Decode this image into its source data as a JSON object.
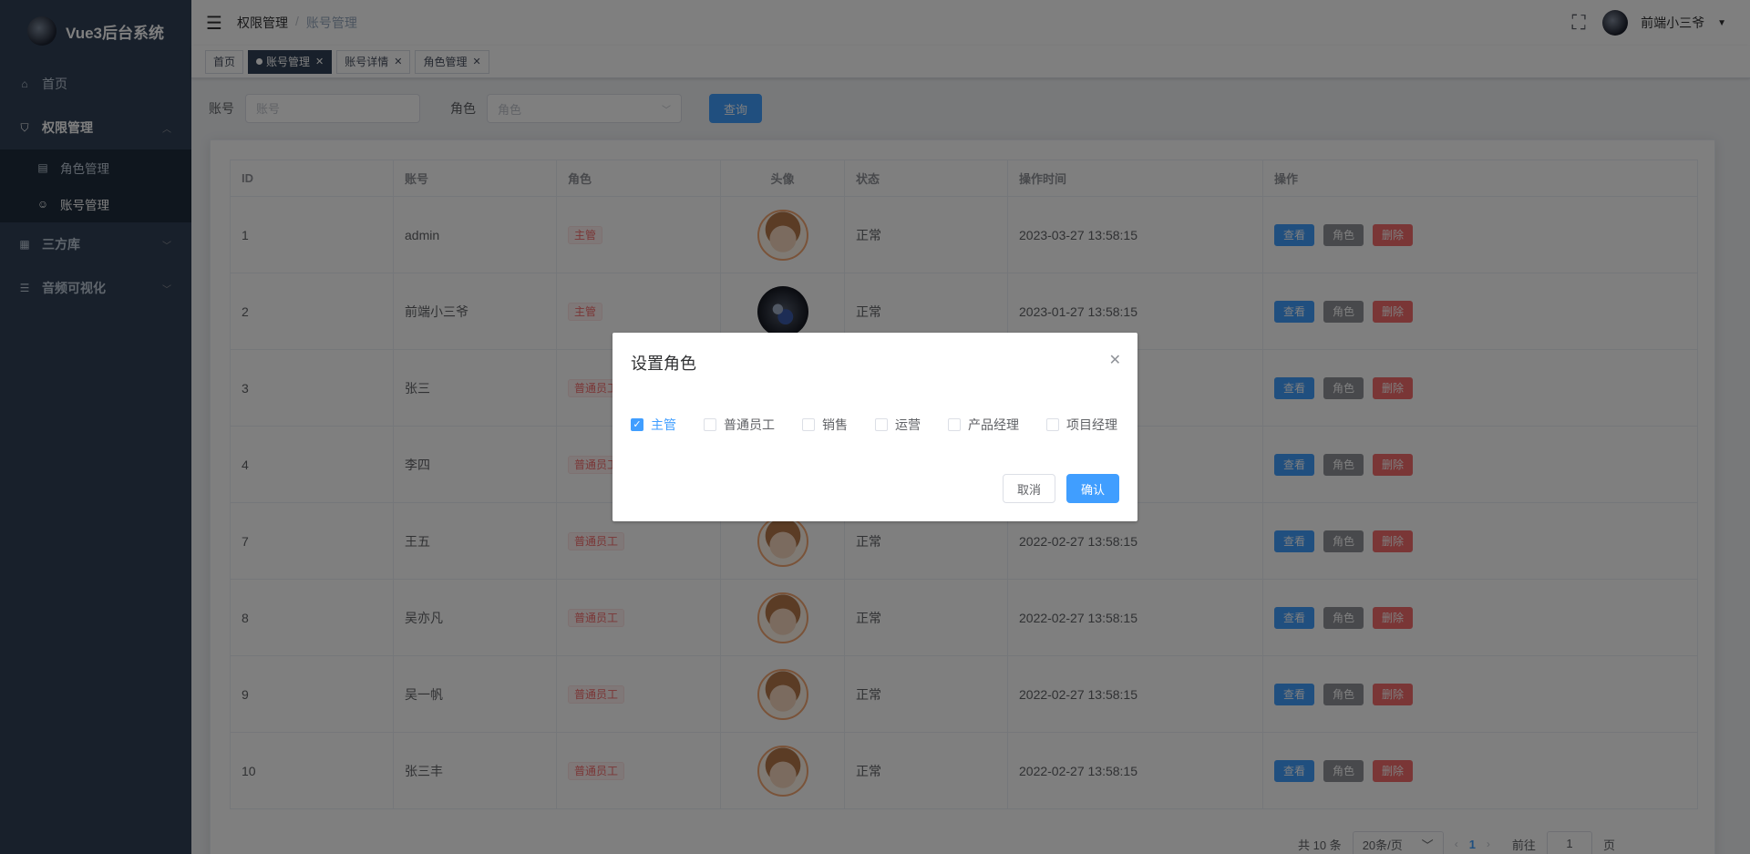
{
  "app": {
    "title": "Vue3后台系统"
  },
  "sidebar": {
    "home": "首页",
    "permission": "权限管理",
    "role_mgmt": "角色管理",
    "account_mgmt": "账号管理",
    "third_party": "三方库",
    "audio_vis": "音频可视化"
  },
  "header": {
    "breadcrumb": [
      "权限管理",
      "/",
      "账号管理"
    ],
    "user_name": "前端小三爷"
  },
  "tags": [
    "首页",
    "账号管理",
    "账号详情",
    "角色管理"
  ],
  "search": {
    "account_label": "账号",
    "account_placeholder": "账号",
    "role_label": "角色",
    "role_placeholder": "角色",
    "query_button": "查询"
  },
  "table": {
    "headers": [
      "ID",
      "账号",
      "角色",
      "头像",
      "状态",
      "操作时间",
      "操作"
    ],
    "actions": {
      "view": "查看",
      "role": "角色",
      "delete": "删除"
    },
    "rows": [
      {
        "id": "1",
        "account": "admin",
        "role": "主管",
        "status": "正常",
        "time": "2023-03-27 13:58:15"
      },
      {
        "id": "2",
        "account": "前端小三爷",
        "role": "主管",
        "status": "正常",
        "time": "2023-01-27 13:58:15"
      },
      {
        "id": "3",
        "account": "张三",
        "role": "普通员工",
        "status": "",
        "time": ""
      },
      {
        "id": "4",
        "account": "李四",
        "role": "普通员工",
        "status": "",
        "time": ""
      },
      {
        "id": "7",
        "account": "王五",
        "role": "普通员工",
        "status": "正常",
        "time": "2022-02-27 13:58:15"
      },
      {
        "id": "8",
        "account": "吴亦凡",
        "role": "普通员工",
        "status": "正常",
        "time": "2022-02-27 13:58:15"
      },
      {
        "id": "9",
        "account": "吴一帆",
        "role": "普通员工",
        "status": "正常",
        "time": "2022-02-27 13:58:15"
      },
      {
        "id": "10",
        "account": "张三丰",
        "role": "普通员工",
        "status": "正常",
        "time": "2022-02-27 13:58:15"
      }
    ]
  },
  "pagination": {
    "total": "共 10 条",
    "page_size": "20条/页",
    "current": "1",
    "goto_label": "前往",
    "goto_value": "1",
    "page_suffix": "页"
  },
  "dialog": {
    "title": "设置角色",
    "options": [
      {
        "label": "主管",
        "checked": true
      },
      {
        "label": "普通员工",
        "checked": false
      },
      {
        "label": "销售",
        "checked": false
      },
      {
        "label": "运营",
        "checked": false
      },
      {
        "label": "产品经理",
        "checked": false
      },
      {
        "label": "项目经理",
        "checked": false
      }
    ],
    "cancel": "取消",
    "confirm": "确认"
  },
  "colors": {
    "sidebar": "#304156",
    "primary": "#409eff",
    "danger": "#f56c6c",
    "info": "#909399"
  }
}
